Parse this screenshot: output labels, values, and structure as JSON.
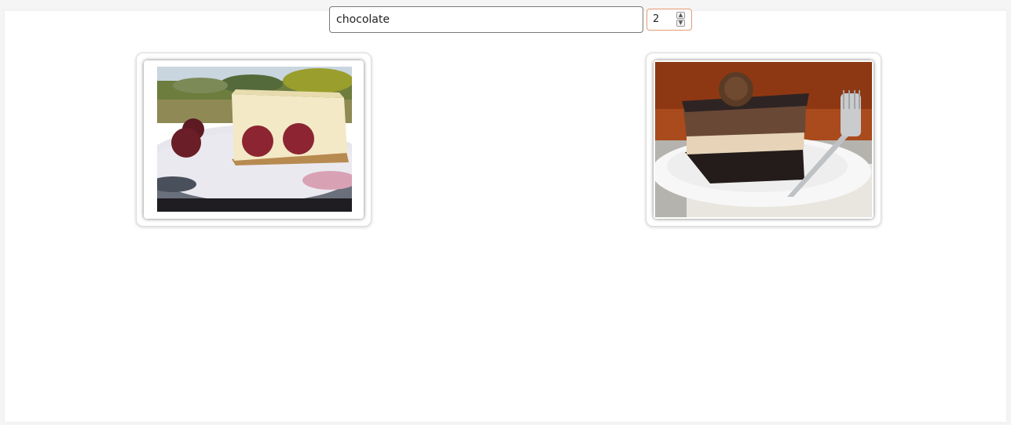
{
  "search": {
    "value": "chocolate"
  },
  "count": {
    "value": "2",
    "up_glyph": "▲",
    "down_glyph": "▼"
  },
  "results": [
    {
      "icon": "cheesecake-photo"
    },
    {
      "icon": "chocolate-dessert-photo"
    }
  ],
  "colors": {
    "page_bg": "#f5f5f5",
    "content_bg": "#ffffff",
    "spinner_border": "#e69a72",
    "input_border": "#7a7a7a"
  }
}
